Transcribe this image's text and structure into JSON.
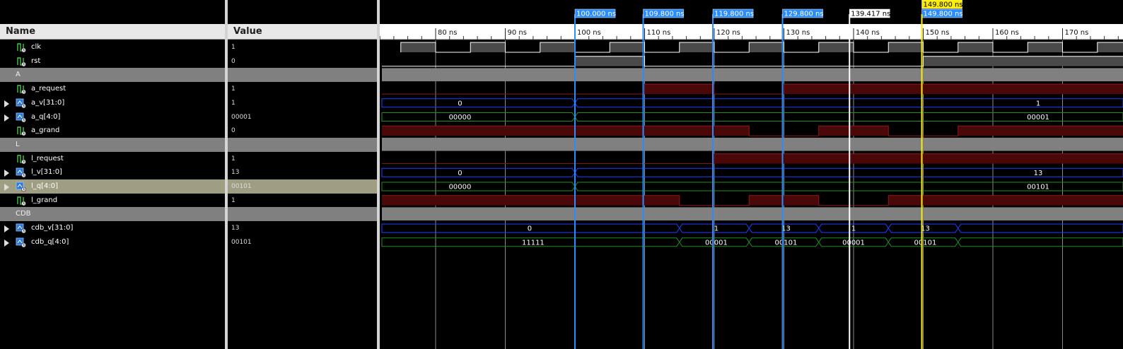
{
  "columns": {
    "name": "Name",
    "value": "Value"
  },
  "signals": [
    {
      "id": "clk",
      "name": "clk",
      "value": "1",
      "kind": "bit",
      "icon": "logic-signal-icon"
    },
    {
      "id": "rst",
      "name": "rst",
      "value": "0",
      "kind": "bit",
      "icon": "logic-signal-icon"
    },
    {
      "id": "grp-a",
      "name": "A",
      "value": "",
      "kind": "group"
    },
    {
      "id": "a_request",
      "name": "a_request",
      "value": "1",
      "kind": "bit",
      "icon": "logic-signal-icon"
    },
    {
      "id": "a_v",
      "name": "a_v[31:0]",
      "value": "1",
      "kind": "bus",
      "icon": "bus-signal-icon"
    },
    {
      "id": "a_q",
      "name": "a_q[4:0]",
      "value": "00001",
      "kind": "bus",
      "icon": "bus-signal-icon"
    },
    {
      "id": "a_grand",
      "name": "a_grand",
      "value": "0",
      "kind": "bit",
      "icon": "logic-signal-icon"
    },
    {
      "id": "grp-l",
      "name": "L",
      "value": "",
      "kind": "group"
    },
    {
      "id": "l_request",
      "name": "l_request",
      "value": "1",
      "kind": "bit",
      "icon": "logic-signal-icon"
    },
    {
      "id": "l_v",
      "name": "l_v[31:0]",
      "value": "13",
      "kind": "bus",
      "icon": "bus-signal-icon"
    },
    {
      "id": "l_q",
      "name": "l_q[4:0]",
      "value": "00101",
      "kind": "bus",
      "icon": "bus-signal-icon",
      "selected": true
    },
    {
      "id": "l_grand",
      "name": "l_grand",
      "value": "1",
      "kind": "bit",
      "icon": "logic-signal-icon"
    },
    {
      "id": "grp-cdb",
      "name": "CDB",
      "value": "",
      "kind": "group"
    },
    {
      "id": "cdb_v",
      "name": "cdb_v[31:0]",
      "value": "13",
      "kind": "bus",
      "icon": "bus-signal-icon"
    },
    {
      "id": "cdb_q",
      "name": "cdb_q[4:0]",
      "value": "00101",
      "kind": "bus",
      "icon": "bus-signal-icon"
    }
  ],
  "timeline": {
    "ticks": [
      {
        "t": 80,
        "label": "80 ns"
      },
      {
        "t": 90,
        "label": "90 ns"
      },
      {
        "t": 100,
        "label": "100 ns"
      },
      {
        "t": 110,
        "label": "110 ns"
      },
      {
        "t": 120,
        "label": "120 ns"
      },
      {
        "t": 130,
        "label": "130 ns"
      },
      {
        "t": 140,
        "label": "140 ns"
      },
      {
        "t": 150,
        "label": "150 ns"
      },
      {
        "t": 160,
        "label": "160 ns"
      },
      {
        "t": 170,
        "label": "170 ns"
      }
    ]
  },
  "cursors": [
    {
      "t": 100.0,
      "label": "100.000 ns",
      "kind": "marker"
    },
    {
      "t": 109.8,
      "label": "109.800 ns",
      "kind": "marker"
    },
    {
      "t": 119.8,
      "label": "119.800 ns",
      "kind": "marker"
    },
    {
      "t": 129.8,
      "label": "129.800 ns",
      "kind": "marker"
    },
    {
      "t": 139.417,
      "label": "139.417 ns",
      "kind": "main"
    },
    {
      "t": 149.8,
      "label": "149.800 ns",
      "kind": "marker"
    },
    {
      "t": 149.8,
      "label": "149.800 ns",
      "kind": "active"
    }
  ],
  "waves": {
    "a_v": {
      "labels": [
        {
          "t": 83.5,
          "text": "0"
        },
        {
          "t": 166.5,
          "text": "1"
        }
      ]
    },
    "a_q": {
      "labels": [
        {
          "t": 83.5,
          "text": "00000"
        },
        {
          "t": 166.5,
          "text": "00001"
        }
      ]
    },
    "l_v": {
      "labels": [
        {
          "t": 83.5,
          "text": "0"
        },
        {
          "t": 166.5,
          "text": "13"
        }
      ]
    },
    "l_q": {
      "labels": [
        {
          "t": 83.5,
          "text": "00000"
        },
        {
          "t": 166.5,
          "text": "00101"
        }
      ]
    },
    "cdb_v": {
      "labels": [
        {
          "t": 93.5,
          "text": "0"
        },
        {
          "t": 120.3,
          "text": "1"
        },
        {
          "t": 130.3,
          "text": "13"
        },
        {
          "t": 140.0,
          "text": "1"
        },
        {
          "t": 150.3,
          "text": "13"
        }
      ]
    },
    "cdb_q": {
      "labels": [
        {
          "t": 94.0,
          "text": "11111"
        },
        {
          "t": 120.3,
          "text": "00001"
        },
        {
          "t": 130.3,
          "text": "00101"
        },
        {
          "t": 140.0,
          "text": "00001"
        },
        {
          "t": 150.3,
          "text": "00101"
        }
      ]
    }
  },
  "colors": {
    "clk_line": "#ffffff",
    "clk_fill": "#4a4a4a",
    "red_line": "#8b1a1a",
    "red_fill": "#4a0808",
    "bus_blue": "#1e40ff",
    "bus_green": "#1f8f1f",
    "cursor_blue": "#2a8cff",
    "cursor_yellow": "#ffee00",
    "cursor_white": "#ffffff",
    "grid": "#8a8a8a"
  }
}
